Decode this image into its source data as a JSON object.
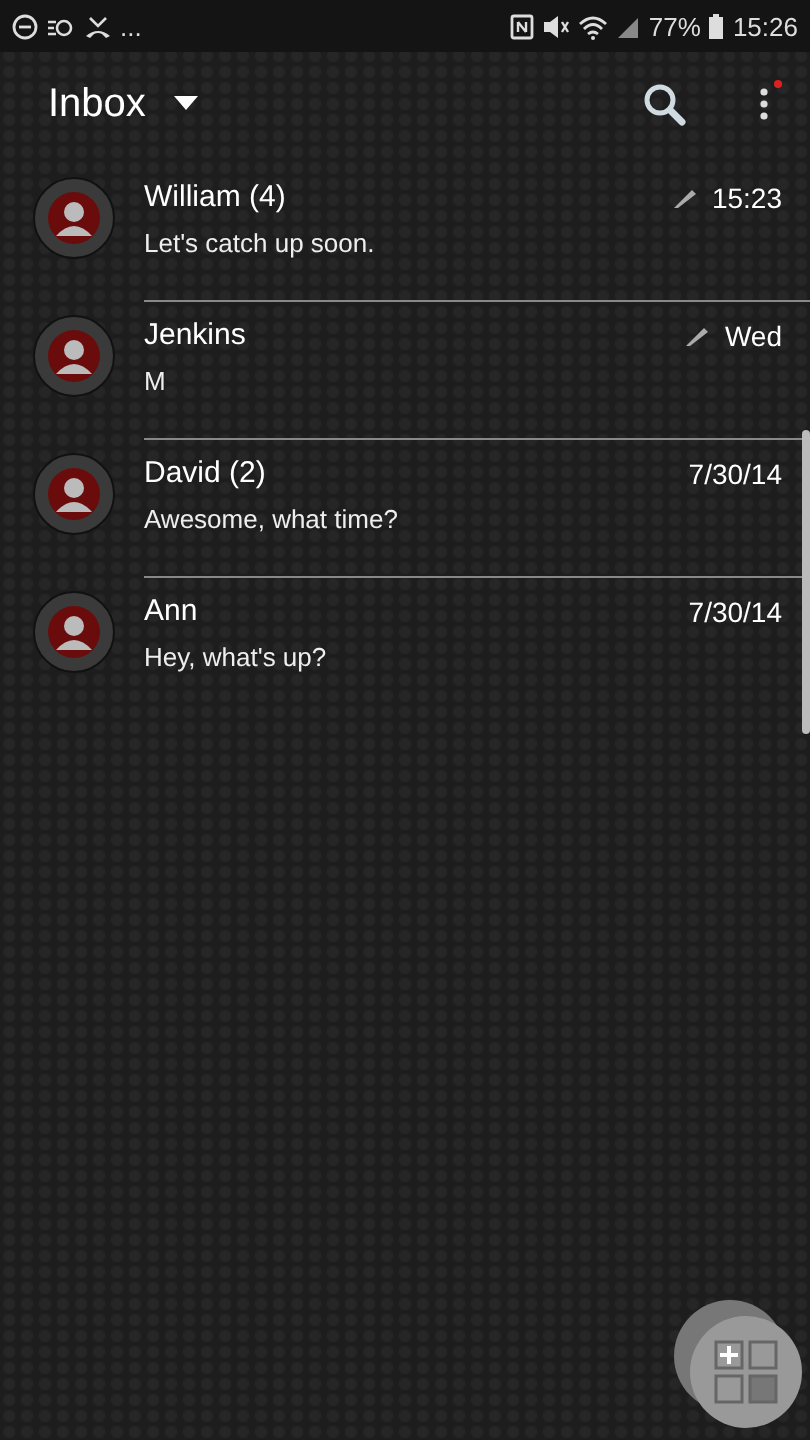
{
  "status_bar": {
    "more": "...",
    "battery": "77%",
    "time": "15:26"
  },
  "app_bar": {
    "title": "Inbox"
  },
  "threads": [
    {
      "name": "William (4)",
      "preview": "Let's catch up soon.",
      "time": "15:23",
      "draft": true
    },
    {
      "name": "Jenkins",
      "preview": "M",
      "time": "Wed",
      "draft": true
    },
    {
      "name": "David (2)",
      "preview": "Awesome, what time?",
      "time": "7/30/14",
      "draft": false
    },
    {
      "name": "Ann",
      "preview": "Hey, what's up?",
      "time": "7/30/14",
      "draft": false
    }
  ]
}
